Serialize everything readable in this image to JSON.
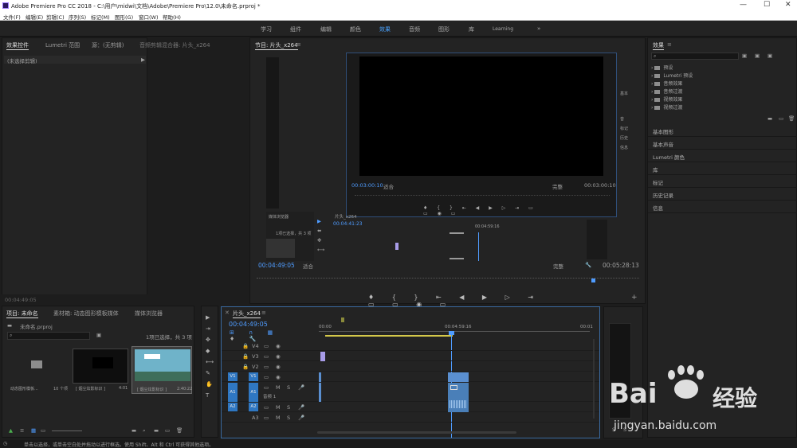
{
  "window": {
    "title": "Adobe Premiere Pro CC 2018 - C:\\用户\\midwi\\文档\\Adobe\\Premiere Pro\\12.0\\未命名.prproj *"
  },
  "menu": [
    "文件(F)",
    "编辑(E)",
    "剪辑(C)",
    "序列(S)",
    "标记(M)",
    "图形(G)",
    "窗口(W)",
    "帮助(H)"
  ],
  "workspaces": {
    "items": [
      "学习",
      "组件",
      "编辑",
      "颜色",
      "效果",
      "音频",
      "图形",
      "库",
      "Learning"
    ],
    "active": "效果",
    "more": "»"
  },
  "effect_controls": {
    "tabs": [
      "效果控件",
      "Lumetri 范围",
      "源：(无剪辑)",
      "音频剪辑混合器: 片头_x264"
    ],
    "empty": "(未选择剪辑)",
    "timecode": "00:04:49:05"
  },
  "program": {
    "title": "节目: 片头_x264",
    "inner_tc_left": "00:03:00:10",
    "inner_fit": "适合",
    "inner_full": "完整",
    "inner_tc_right": "00:03:00:10",
    "right_labels": [
      "基本",
      "音",
      "标记",
      "历史",
      "信息"
    ],
    "nested_seq": "片头_x264",
    "nested_tc": "00:04:41:23",
    "nested_time": "00:04:59:16",
    "media_browser": "媒体浏览器",
    "selected_info": "1项已选择，共 3 项",
    "tc_left": "00:04:49:05",
    "fit": "适合",
    "full": "完整",
    "tc_right": "00:05:28:13"
  },
  "project": {
    "tabs": [
      "项目: 未命名",
      "素材箱: 动态图形模板媒体",
      "媒体浏览器"
    ],
    "file": "未命名.prproj",
    "count": "1项已选择，共 3 项",
    "items": [
      {
        "name": "动态图形模板...",
        "meta": "10 个项"
      },
      {
        "name": "[ 烟尘炫影标识 ]",
        "meta": "4:01"
      },
      {
        "name": "[ 烟尘炫影标识 ]",
        "meta": "2:40:22"
      }
    ]
  },
  "timeline": {
    "title": "片头_x264",
    "tc": "00:04:49:05",
    "ruler": [
      "00:00",
      "00:04:59:16",
      "00:01"
    ],
    "tracks": [
      {
        "id": "V4"
      },
      {
        "id": "V3"
      },
      {
        "id": "V2"
      },
      {
        "id": "V1",
        "toggle": "V1"
      },
      {
        "id": "A1",
        "toggle": "A1",
        "label": "音频 1"
      },
      {
        "id": "A2",
        "toggle": "A2"
      },
      {
        "id": "A3"
      }
    ],
    "clip_label": "片头_x264",
    "btn_m": "M",
    "btn_s": "S"
  },
  "effects": {
    "title": "效果",
    "tree": [
      "预设",
      "Lumetri 预设",
      "音频效果",
      "音频过渡",
      "视频效果",
      "视频过渡"
    ],
    "panels": [
      "基本图形",
      "基本声音",
      "Lumetri 颜色",
      "库",
      "标记",
      "历史记录",
      "信息"
    ]
  },
  "status": "单击以选择，或单击空白处并拖动以进行框选。使用 Shift、Alt 和 Ctrl 可获得其他选项。",
  "watermark": {
    "brand": "Bai",
    "brand2": "经验",
    "url": "jingyan.baidu.com"
  }
}
